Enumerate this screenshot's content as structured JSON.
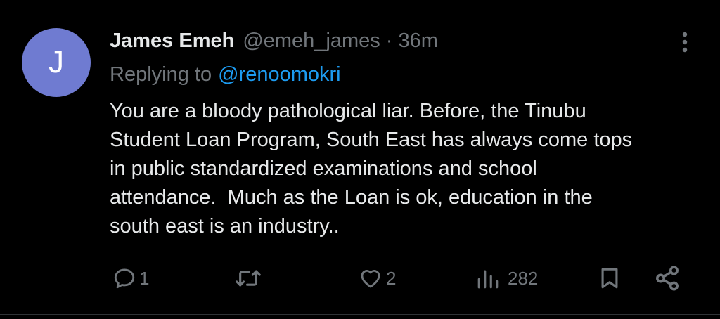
{
  "colors": {
    "background": "#000000",
    "avatar": "#6f7bd1",
    "text": "#e7e9ea",
    "secondary_text": "#71767b",
    "link": "#1d9bf0"
  },
  "tweet": {
    "avatar_letter": "J",
    "display_name": "James Emeh",
    "handle": "@emeh_james",
    "separator": "·",
    "time": "36m",
    "more_icon": "more-vertical-icon",
    "replying_prefix": "Replying to",
    "replying_handle": "@renoomokri",
    "body_lines": [
      "You are a bloody pathological liar. Before, the Tinubu",
      "Student Loan Program, South East has always come tops",
      "in public standardized examinations and school",
      "attendance.  Much as the Loan is ok, education in the",
      "south east is an industry.."
    ]
  },
  "actions": {
    "reply": {
      "icon": "reply-icon",
      "count": "1"
    },
    "retweet": {
      "icon": "retweet-icon",
      "count": ""
    },
    "like": {
      "icon": "heart-icon",
      "count": "2"
    },
    "views": {
      "icon": "views-icon",
      "count": "282"
    },
    "bookmark": {
      "icon": "bookmark-icon"
    },
    "share": {
      "icon": "share-icon"
    }
  }
}
